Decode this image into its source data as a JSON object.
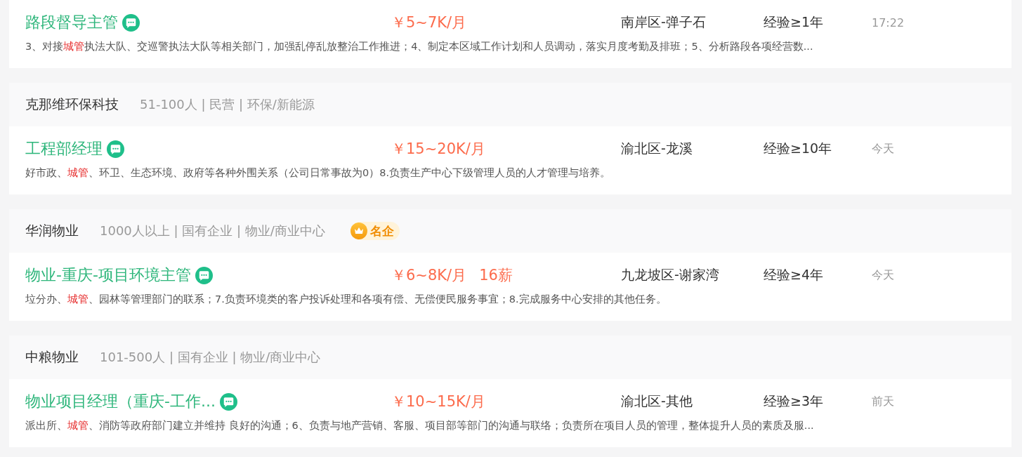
{
  "listings": [
    {
      "job": {
        "title": "路段督导主管",
        "salary": "￥5~7K/月",
        "location": "南岸区-弹子石",
        "experience": "经验≥1年",
        "time": "17:22",
        "description": [
          {
            "text": "3、对接",
            "highlight": false
          },
          {
            "text": "城管",
            "highlight": true
          },
          {
            "text": "执法大队、交巡警执法大队等相关部门，加强乱停乱放整治工作推进；4、制定本区域工作计划和人员调动，落实月度考勤及排班；5、分析路段各项经营数...",
            "highlight": false
          }
        ]
      }
    },
    {
      "company": {
        "name": "克那维环保科技",
        "info": "51-100人 | 民营 | 环保/新能源",
        "famous": false
      },
      "job": {
        "title": "工程部经理",
        "salary": "￥15~20K/月",
        "location": "渝北区-龙溪",
        "experience": "经验≥10年",
        "time": "今天",
        "description": [
          {
            "text": "好市政、",
            "highlight": false
          },
          {
            "text": "城管",
            "highlight": true
          },
          {
            "text": "、环卫、生态环境、政府等各种外围关系（公司日常事故为0）8.负责生产中心下级管理人员的人才管理与培养。",
            "highlight": false
          }
        ]
      }
    },
    {
      "company": {
        "name": "华润物业",
        "info": "1000人以上 | 国有企业 | 物业/商业中心",
        "famous": true,
        "badge": "名企"
      },
      "job": {
        "title": "物业-重庆-项目环境主管",
        "salary": "￥6~8K/月",
        "salary_extra": "16薪",
        "location": "九龙坡区-谢家湾",
        "experience": "经验≥4年",
        "time": "今天",
        "description": [
          {
            "text": "垃分办、",
            "highlight": false
          },
          {
            "text": "城管",
            "highlight": true
          },
          {
            "text": "、园林等管理部门的联系；7.负责环境类的客户投诉处理和各项有偿、无偿便民服务事宜；8.完成服务中心安排的其他任务。",
            "highlight": false
          }
        ]
      }
    },
    {
      "company": {
        "name": "中粮物业",
        "info": "101-500人 | 国有企业 | 物业/商业中心",
        "famous": false
      },
      "job": {
        "title": "物业项目经理（重庆-工作...",
        "salary": "￥10~15K/月",
        "location": "渝北区-其他",
        "experience": "经验≥3年",
        "time": "前天",
        "description": [
          {
            "text": "派出所、",
            "highlight": false
          },
          {
            "text": "城管",
            "highlight": true
          },
          {
            "text": "、消防等政府部门建立并维持 良好的沟通；6、负责与地产营销、客服、项目部等部门的沟通与联络；负责所在项目人员的管理，整体提升人员的素质及服...",
            "highlight": false
          }
        ]
      }
    }
  ]
}
